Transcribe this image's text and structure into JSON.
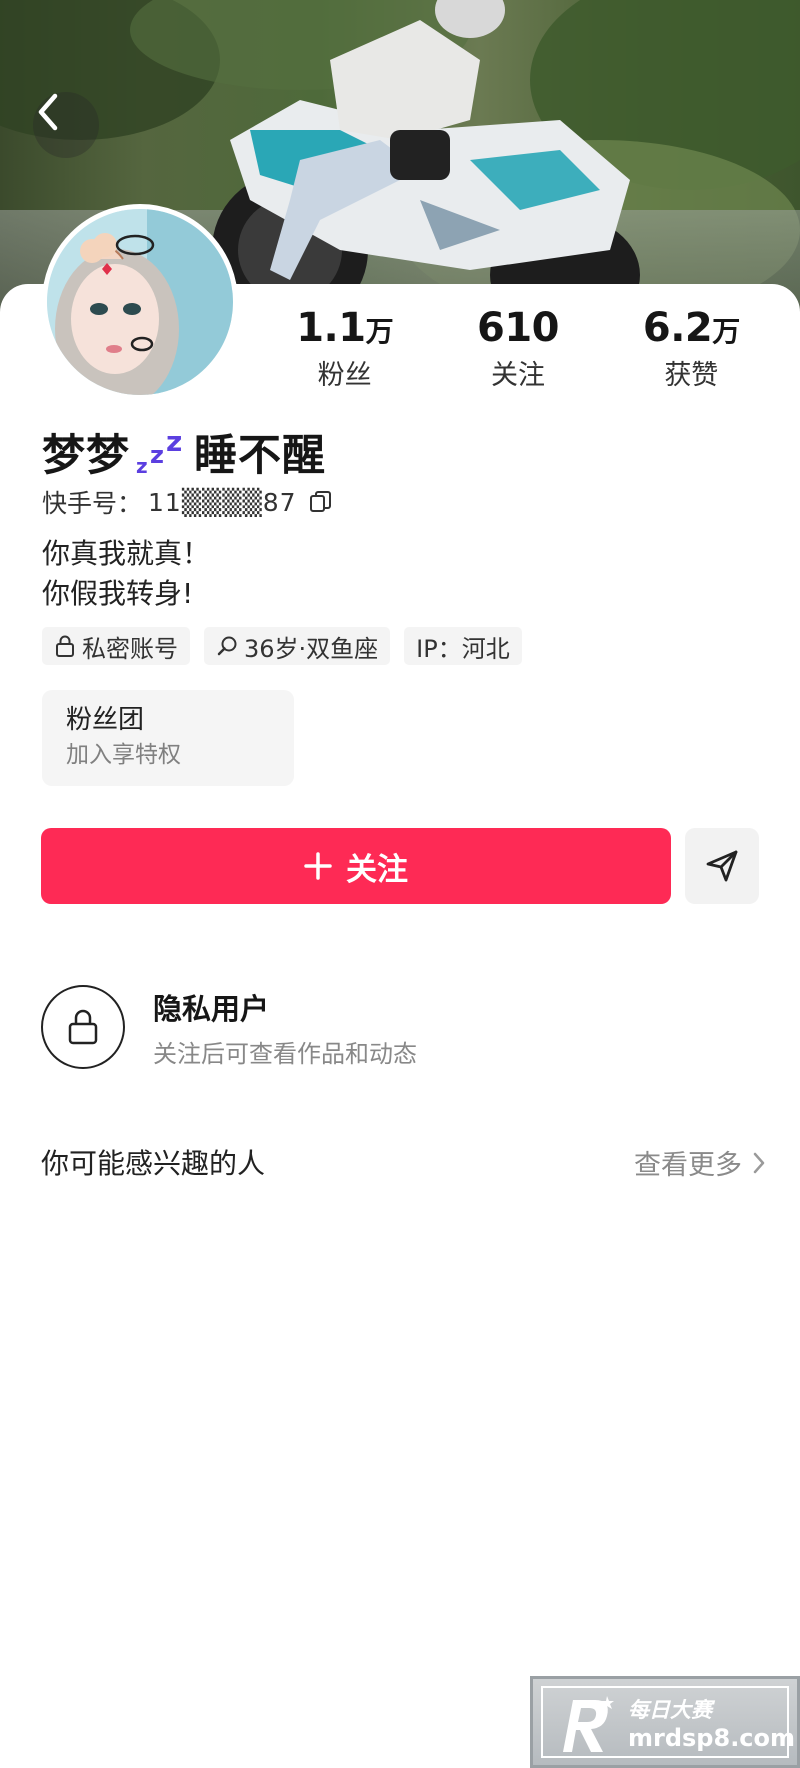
{
  "header": {
    "back_icon": "chevron-left-icon"
  },
  "profile": {
    "name_part1": "梦梦",
    "name_part2": "睡不醒",
    "name_emoji": "zzz-sleep",
    "kuaishou_label": "快手号：",
    "kuaishou_id": "11▒▒▒▒87",
    "bio_line1": "你真我就真！",
    "bio_line2": "你假我转身!"
  },
  "stats": [
    {
      "num": "1.1",
      "unit": "万",
      "label": "粉丝"
    },
    {
      "num": "610",
      "unit": "",
      "label": "关注"
    },
    {
      "num": "6.2",
      "unit": "万",
      "label": "获赞"
    }
  ],
  "tags": [
    {
      "icon": "lock-icon",
      "text": "私密账号"
    },
    {
      "icon": "search-icon",
      "text": "36岁·双鱼座"
    },
    {
      "icon": "",
      "text": "IP：河北"
    }
  ],
  "fans_group": {
    "title": "粉丝团",
    "subtitle": "加入享特权"
  },
  "actions": {
    "follow_label": "关注",
    "share_icon": "send-icon"
  },
  "private_notice": {
    "title": "隐私用户",
    "subtitle": "关注后可查看作品和动态"
  },
  "recommend": {
    "title": "你可能感兴趣的人",
    "see_more": "查看更多"
  },
  "watermark": {
    "cn": "每日大赛",
    "en": "mrdsp8.com"
  },
  "colors": {
    "accent": "#fe2a55",
    "zzz": "#5b3fe0"
  }
}
